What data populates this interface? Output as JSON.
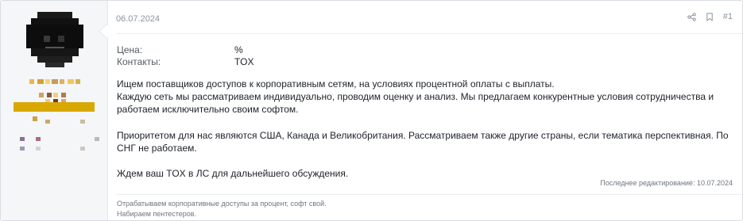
{
  "post": {
    "date": "06.07.2024",
    "number": "#1",
    "fields": [
      {
        "label": "Цена:",
        "value": "%"
      },
      {
        "label": "Контакты:",
        "value": "TOX"
      }
    ],
    "body": [
      "Ищем поставщиков доступов к корпоративным сетям, на условиях процентной оплаты с выплаты.",
      "Каждую сеть мы рассматриваем индивидуально, проводим оценку и анализ. Мы предлагаем конкурентные условия сотрудничества и работаем исключительно своим софтом.",
      "Приоритетом для нас являются США, Канада и Великобритания. Рассматриваем также другие страны, если тематика перспективная. По СНГ не работаем.",
      "Ждем ваш TOX в ЛС для дальнейшего обсуждения."
    ],
    "last_edited": "Последнее редактирование: 10.07.2024",
    "signature": [
      "Отрабатываем корпоративные доступы за процент, софт свой.",
      "Набираем пентестеров."
    ],
    "icons": {
      "share": "share-icon",
      "bookmark": "bookmark-icon"
    }
  },
  "colors": {
    "user_panel_bg": "#f5f6f8",
    "border": "#d8dde3",
    "meta_text": "#8c949d",
    "body_text": "#1d2129"
  }
}
